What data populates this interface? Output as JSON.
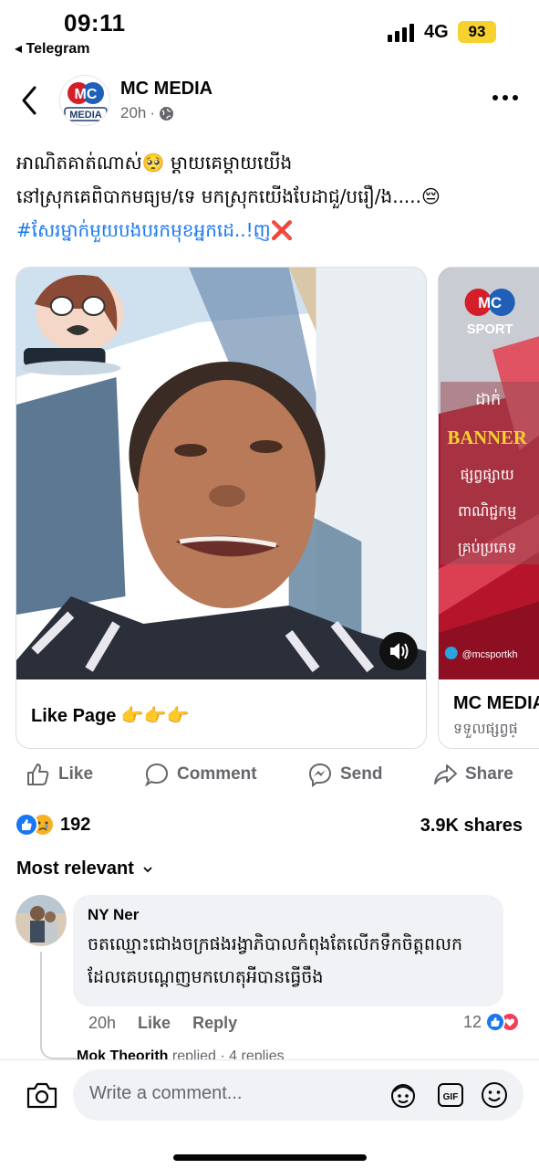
{
  "status_bar": {
    "time": "09:11",
    "back_app": "◂ Telegram",
    "network": "4G",
    "battery": "93"
  },
  "post": {
    "page_name": "MC MEDIA",
    "time_ago": "20h",
    "caption_line1": "អាណិតគាត់ណាស់🥺 ម្ដាយគេម្ដាយយើង",
    "caption_line2": "នៅស្រុកគេពិបាកមធ្យម/ទេ មកស្រុកយើងបែដាជួ/បរឿ/ង.....😔",
    "caption_tag": "#សែរម្នាក់មួយបងបរកមុខអ្នកដេ..!ញ❌",
    "avatar_logo_top": "MC",
    "avatar_logo_bottom": "MEDIA"
  },
  "carousel": {
    "card1_label": "Like Page 👉👉👉",
    "card2_title": "MC MEDIA",
    "card2_subtitle": "ទទួលផ្សព្វផ្",
    "card2_logo_top": "MC",
    "card2_logo_bottom": "SPORT",
    "card2_line1": "ដាក់",
    "card2_banner": "BANNER",
    "card2_line2": "ផ្សព្វផ្សាយ",
    "card2_line3": "ពាណិជ្ជកម្ម",
    "card2_line4": "គ្រប់ប្រភេទ",
    "card2_handle": "@mcsportkh"
  },
  "actions": {
    "like": "Like",
    "comment": "Comment",
    "send": "Send",
    "share": "Share"
  },
  "stats": {
    "reaction_count": "192",
    "shares": "3.9K shares",
    "sort_label": "Most relevant"
  },
  "comment": {
    "author": "NY Ner",
    "text_line1": "ចតឈ្មោះជោងចក្រផងរង្វាភិបាលកំពុងតែលើកទឹកចិត្តពលក",
    "text_line2": "ដែលគេបណ្ដេញមកហេតុអីបានធ្វើចឹង",
    "time": "20h",
    "like_label": "Like",
    "reply_label": "Reply",
    "reaction_count": "12",
    "replies_author": "Mok Theorith",
    "replies_text": "replied · 4 replies"
  },
  "composer": {
    "placeholder": "Write a comment..."
  },
  "colors": {
    "facebook_blue": "#1877f2",
    "battery_yellow": "#f7d12e",
    "love_red": "#f33e58",
    "card_red": "#b5142b"
  }
}
